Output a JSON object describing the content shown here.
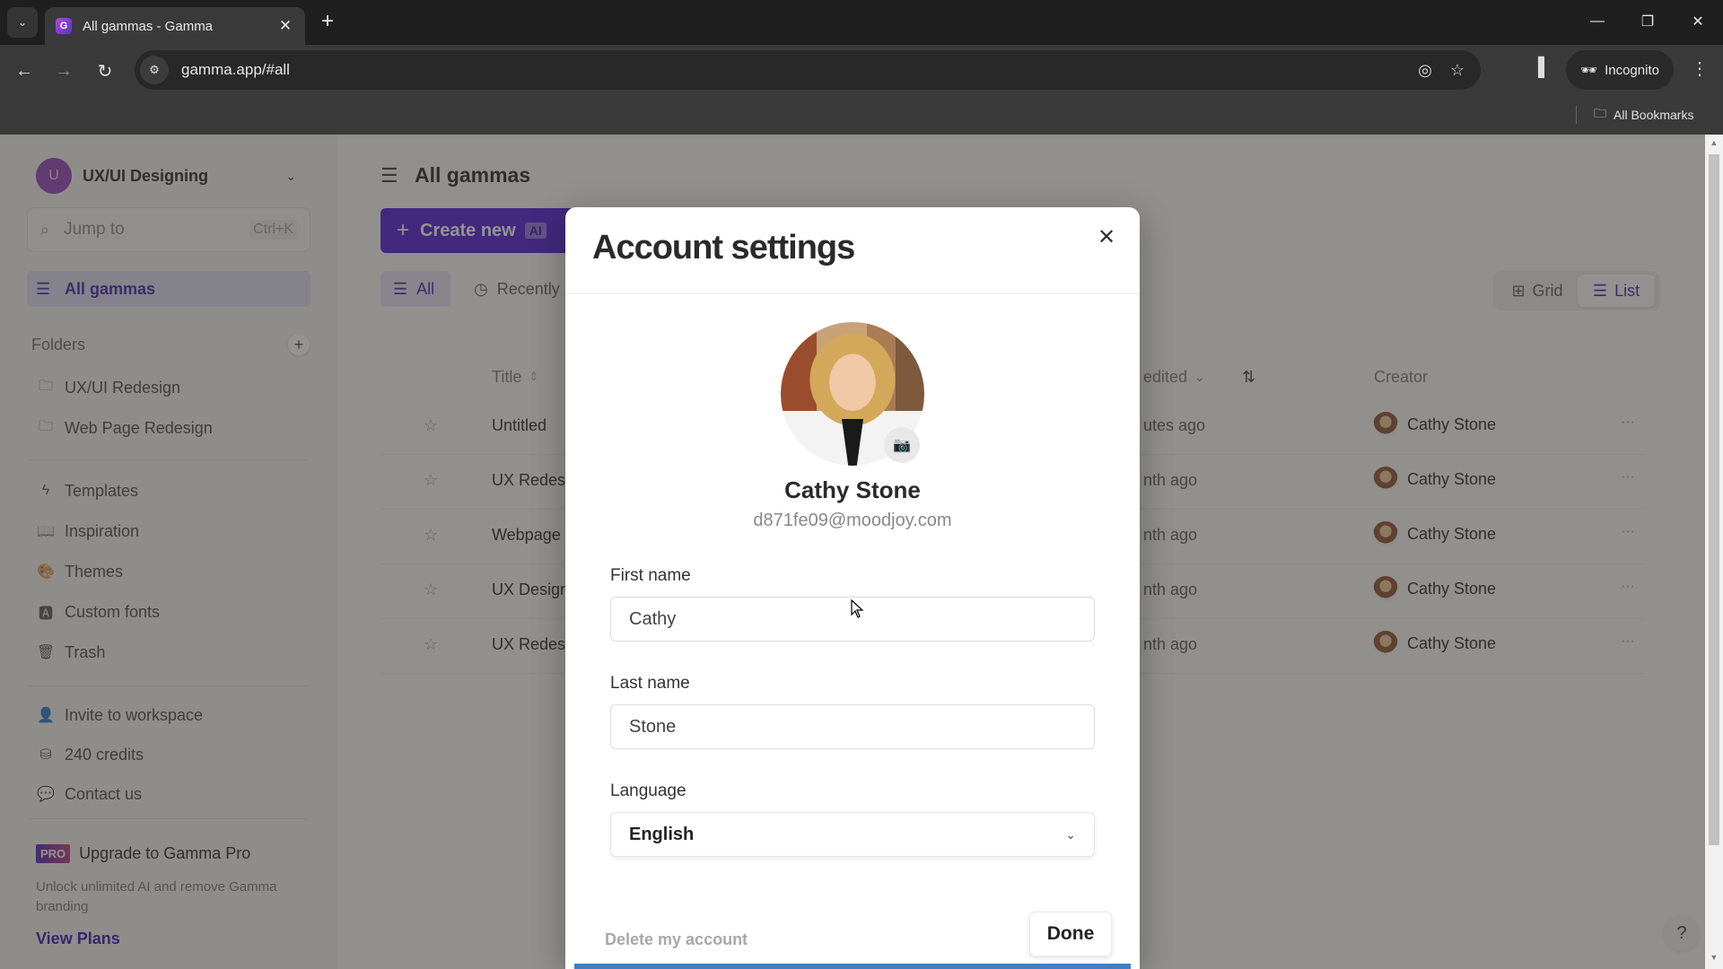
{
  "browser": {
    "tab_title": "All gammas - Gamma",
    "tab_favicon": "G",
    "tab_search_icon": "⌄",
    "tab_close": "✕",
    "new_tab": "+",
    "window": {
      "minimize": "—",
      "restore": "❐",
      "close": "✕"
    },
    "nav": {
      "back": "←",
      "forward": "→",
      "reload": "↻"
    },
    "url": "gamma.app/#all",
    "site_info_icon": "⚙",
    "eye_off_icon": "◎",
    "bookmark_star": "☆",
    "side_panel_icon": "▐",
    "incognito_label": "Incognito",
    "incognito_icon": "🕶",
    "menu_icon": "⋮",
    "all_bookmarks": "All Bookmarks",
    "bookmarks_folder_icon": "🗀"
  },
  "sidebar": {
    "workspace_initial": "U",
    "workspace_name": "UX/UI Designing",
    "workspace_chevron": "⌄",
    "jump_placeholder": "Jump to",
    "jump_shortcut": "Ctrl+K",
    "active_item": {
      "icon": "☰",
      "label": "All gammas"
    },
    "folders_label": "Folders",
    "folders_add": "+",
    "folders": [
      {
        "icon": "🗀",
        "label": "UX/UI Redesign"
      },
      {
        "icon": "🗀",
        "label": "Web Page Redesign"
      }
    ],
    "nav_items": [
      {
        "icon": "ϟ",
        "label": "Templates"
      },
      {
        "icon": "📖",
        "label": "Inspiration"
      },
      {
        "icon": "🎨",
        "label": "Themes"
      },
      {
        "icon": "🅰",
        "label": "Custom fonts"
      },
      {
        "icon": "🗑",
        "label": "Trash"
      }
    ],
    "utility_items": [
      {
        "icon": "👤",
        "label": "Invite to workspace"
      },
      {
        "icon": "⛁",
        "label": "240 credits"
      },
      {
        "icon": "💬",
        "label": "Contact us"
      }
    ],
    "pro_badge": "PRO",
    "pro_title": "Upgrade to Gamma Pro",
    "pro_desc": "Unlock unlimited AI and remove Gamma branding",
    "view_plans": "View Plans"
  },
  "main": {
    "title": "All gammas",
    "title_icon": "☰",
    "create_new": "Create new",
    "create_plus": "+",
    "ai_badge": "AI",
    "filters": [
      {
        "icon": "☰",
        "label": "All",
        "active": true
      },
      {
        "icon": "◷",
        "label": "Recently",
        "active": false
      }
    ],
    "view_toggle": {
      "grid_icon": "⊞",
      "grid_label": "Grid",
      "list_icon": "☰",
      "list_label": "List",
      "selected": "List"
    },
    "table": {
      "columns": {
        "title": "Title",
        "title_sort_icon": "⇕",
        "edited": "edited",
        "edited_chevron": "⌄",
        "sort_icon": "⇅",
        "creator": "Creator"
      },
      "rows": [
        {
          "star": "☆",
          "title": "Untitled",
          "edited": "utes ago",
          "creator": "Cathy Stone",
          "more": "···"
        },
        {
          "star": "☆",
          "title": "UX Redes",
          "edited": "nth ago",
          "creator": "Cathy Stone",
          "more": "···"
        },
        {
          "star": "☆",
          "title": "Webpage",
          "edited": "nth ago",
          "creator": "Cathy Stone",
          "more": "···"
        },
        {
          "star": "☆",
          "title": "UX Desigr",
          "edited": "nth ago",
          "creator": "Cathy Stone",
          "more": "···"
        },
        {
          "star": "☆",
          "title": "UX Redes",
          "edited": "nth ago",
          "creator": "Cathy Stone",
          "more": "···"
        }
      ]
    },
    "help": "?"
  },
  "modal": {
    "title": "Account settings",
    "close": "✕",
    "camera_icon": "📷",
    "name": "Cathy Stone",
    "email": "d871fe09@moodjoy.com",
    "first_name_label": "First name",
    "first_name_value": "Cathy",
    "last_name_label": "Last name",
    "last_name_value": "Stone",
    "language_label": "Language",
    "language_value": "English",
    "language_chevron": "⌄",
    "delete_account": "Delete my account",
    "done": "Done"
  },
  "colors": {
    "brand_purple": "#4a14d4",
    "active_nav_text": "#3a1bb0",
    "workspace_avatar": "#8e3cb8",
    "modal_bottom_bar": "#3f7fc8"
  }
}
